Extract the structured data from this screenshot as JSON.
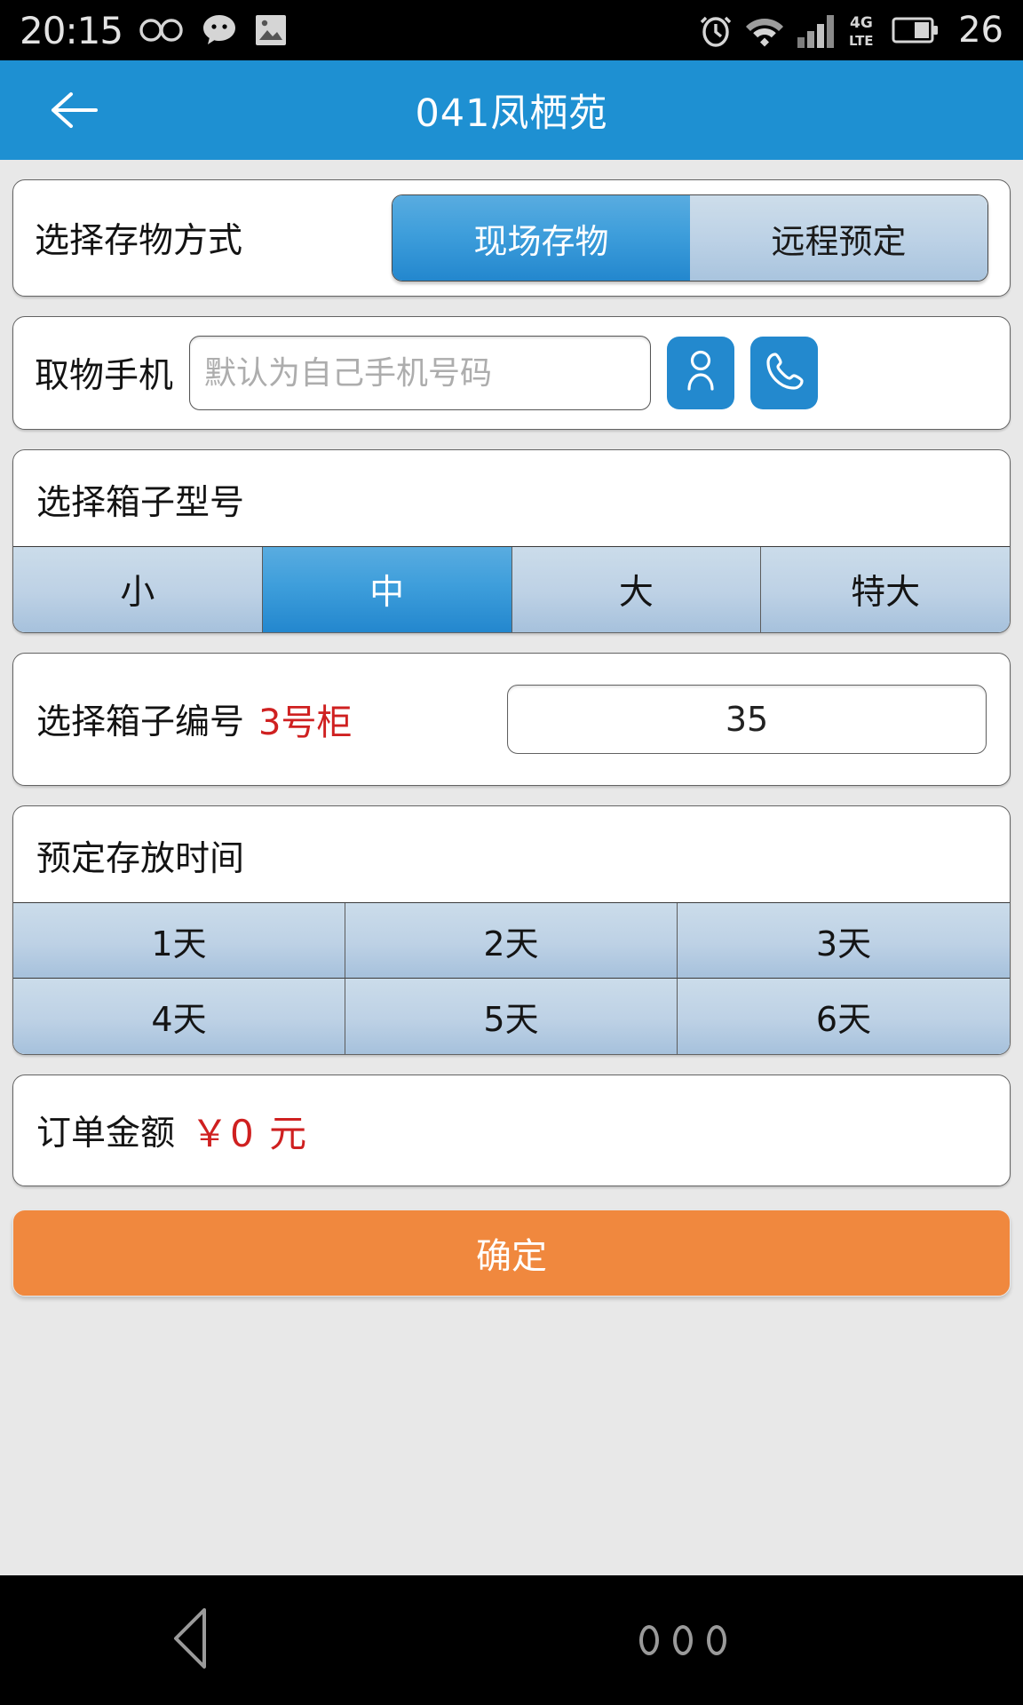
{
  "statusbar": {
    "time": "20:15",
    "battery_level": "26",
    "network": "4G LTE",
    "icons_left": [
      "infinity-icon",
      "chat-bubble-icon",
      "image-icon"
    ],
    "icons_right": [
      "alarm-clock-icon",
      "wifi-icon",
      "signal-bars-icon",
      "lte-icon",
      "battery-icon"
    ]
  },
  "titlebar": {
    "back_icon": "back-arrow-icon",
    "title": "041凤栖苑"
  },
  "method_card": {
    "label": "选择存物方式",
    "options": [
      {
        "label": "现场存物",
        "selected": true
      },
      {
        "label": "远程预定",
        "selected": false
      }
    ]
  },
  "phone_card": {
    "label": "取物手机",
    "input_value": "",
    "input_placeholder": "默认为自己手机号码",
    "buttons": [
      "contact-person-icon",
      "phone-handset-icon"
    ]
  },
  "size_card": {
    "title": "选择箱子型号",
    "options": [
      {
        "label": "小",
        "selected": false
      },
      {
        "label": "中",
        "selected": true
      },
      {
        "label": "大",
        "selected": false
      },
      {
        "label": "特大",
        "selected": false
      }
    ]
  },
  "number_card": {
    "label": "选择箱子编号",
    "cabinet": "3号柜",
    "value": "35"
  },
  "time_card": {
    "title": "预定存放时间",
    "options": [
      {
        "label": "1天",
        "selected": false
      },
      {
        "label": "2天",
        "selected": false
      },
      {
        "label": "3天",
        "selected": false
      },
      {
        "label": "4天",
        "selected": false
      },
      {
        "label": "5天",
        "selected": false
      },
      {
        "label": "6天",
        "selected": false
      }
    ]
  },
  "amount_card": {
    "label": "订单金额",
    "amount": "￥0 元"
  },
  "confirm_button": {
    "label": "确定"
  },
  "navbar": {
    "back_icon": "nav-back-triangle-icon",
    "menu_icon": "nav-three-dots-icon"
  },
  "colors": {
    "accent_blue": "#1e90d2",
    "segment_blue": "#2387ce",
    "segment_light": "#bdd1e5",
    "confirm_orange": "#f0883e",
    "red_text": "#cf2020",
    "page_bg": "#e8e8e8"
  }
}
